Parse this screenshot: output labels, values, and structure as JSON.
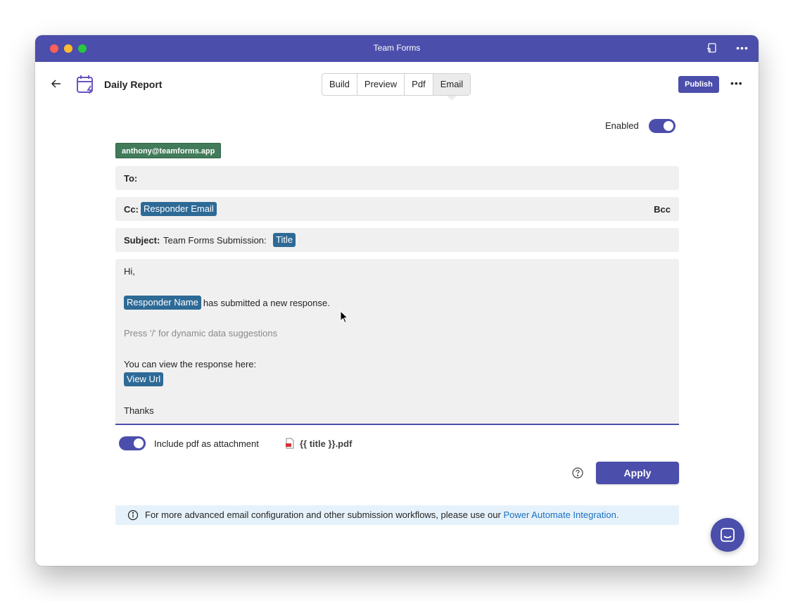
{
  "window": {
    "title": "Team Forms"
  },
  "header": {
    "form_title": "Daily Report",
    "tabs": [
      {
        "label": "Build"
      },
      {
        "label": "Preview"
      },
      {
        "label": "Pdf"
      },
      {
        "label": "Email",
        "active": true
      }
    ],
    "publish_label": "Publish"
  },
  "email": {
    "enabled_label": "Enabled",
    "enabled": true,
    "from": "anthony@teamforms.app",
    "to_label": "To:",
    "to_value": "",
    "cc_label": "Cc:",
    "cc_token": "Responder Email",
    "bcc_label": "Bcc",
    "subject_label": "Subject:",
    "subject_text": "Team Forms Submission:",
    "subject_token": "Title",
    "body": {
      "greeting": "Hi,",
      "responder_token": "Responder Name",
      "submitted_text": "has submitted a new response.",
      "hint": "Press '/' for dynamic data suggestions",
      "view_text": "You can view the response here:",
      "url_token": "View Url",
      "closing": "Thanks"
    },
    "include_pdf_label": "Include pdf as attachment",
    "include_pdf": true,
    "pdf_filename": "{{ title }}.pdf",
    "apply_label": "Apply"
  },
  "info": {
    "text": "For more advanced email configuration and other submission workflows, please use our ",
    "link": "Power Automate Integration."
  },
  "colors": {
    "brand": "#4b4eaa",
    "token": "#2e6a96",
    "from_badge": "#417b5a",
    "info_bg": "#e6f2fb",
    "link": "#1a6fc0"
  }
}
